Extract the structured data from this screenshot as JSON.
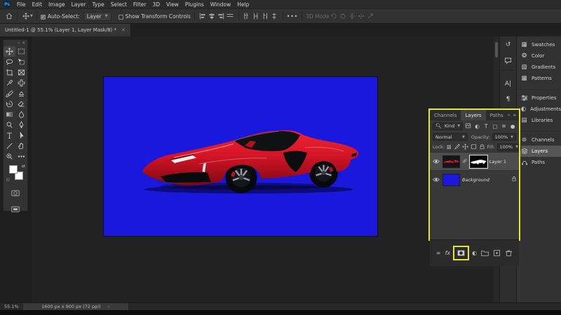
{
  "menu": {
    "logo": "Ps",
    "items": [
      "File",
      "Edit",
      "Image",
      "Layer",
      "Type",
      "Select",
      "Filter",
      "3D",
      "View",
      "Plugins",
      "Window",
      "Help"
    ]
  },
  "options": {
    "auto_select": "Auto-Select:",
    "target": "Layer",
    "show_transform": "Show Transform Controls",
    "more": "•••",
    "mode_3d": "3D Mode"
  },
  "titlebar": {
    "tab_title": "Untitled-1 @ 55.1% (Layer 1, Layer Mask/8) *"
  },
  "tools": {
    "names": [
      "move",
      "rectangular-marquee",
      "lasso",
      "object-selection",
      "crop",
      "frame",
      "eyedropper",
      "spot-healing-brush",
      "brush",
      "clone-stamp",
      "history-brush",
      "eraser",
      "gradient",
      "blur",
      "dodge",
      "pen",
      "type",
      "path-selection",
      "line",
      "hand",
      "zoom",
      "edit-toolbar"
    ],
    "selected": "move"
  },
  "dock": {
    "narrow": [
      "history",
      "comments",
      "character",
      "paragraph"
    ],
    "groups": [
      [
        "Swatches",
        "Color",
        "Gradients",
        "Patterns"
      ],
      [
        "Properties",
        "Adjustments",
        "Libraries"
      ],
      [
        "Channels",
        "Layers",
        "Paths"
      ]
    ],
    "active_item": "Layers"
  },
  "layers_panel": {
    "tabs": [
      "Channels",
      "Layers",
      "Paths"
    ],
    "active_tab": "Layers",
    "filter_label": "Kind",
    "blend_mode": "Normal",
    "opacity_label": "Opacity:",
    "opacity_value": "100%",
    "lock_label": "Lock:",
    "fill_label": "Fill:",
    "fill_value": "100%",
    "layers": [
      {
        "name": "Layer 1",
        "selected": true,
        "has_mask": true,
        "visible": true
      },
      {
        "name": "Background",
        "italic": true,
        "locked": true,
        "visible": true
      }
    ]
  },
  "bottom_bar": {
    "fx_label": "fx",
    "highlighted_button": "add-layer-mask"
  },
  "status": {
    "zoom": "55.1%",
    "doc_info": "1600 px x 900 px (72 ppi)"
  },
  "colors": {
    "highlight_yellow": "#e6e630",
    "canvas_blue": "#1b18dd",
    "car_red": "#d31223",
    "selected_row": "#4d4d4d"
  }
}
